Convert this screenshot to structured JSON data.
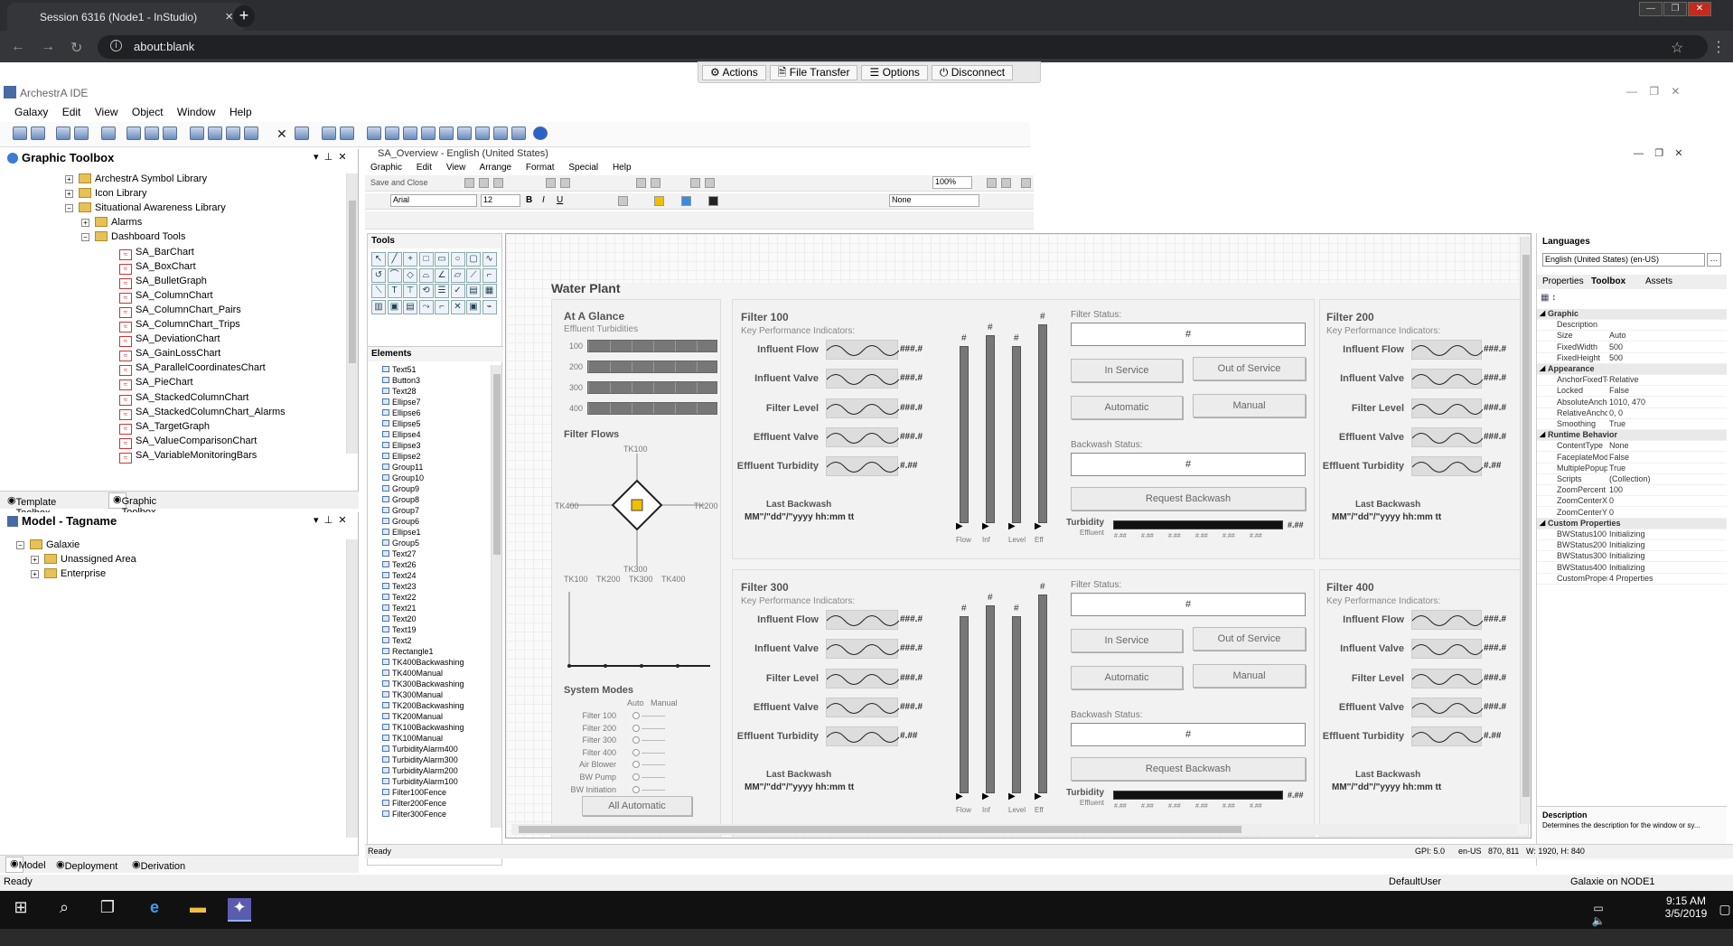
{
  "browser": {
    "tab_title": "Session 6316 (Node1 - InStudio)",
    "new_tab": "+",
    "close_tab": "×",
    "address": "about:blank",
    "minimize": "—",
    "restore": "❐",
    "close": "✕"
  },
  "session_bar": {
    "actions": "Actions",
    "file_transfer": "File Transfer",
    "options": "Options",
    "disconnect": "Disconnect"
  },
  "ide": {
    "title": "ArchestrA IDE",
    "menu": [
      "Galaxy",
      "Edit",
      "View",
      "Object",
      "Window",
      "Help"
    ]
  },
  "graphic_toolbox": {
    "title": "Graphic Toolbox",
    "tree": [
      {
        "label": "ArchestrA Symbol Library",
        "indent": 0,
        "kind": "folder",
        "expander": "+"
      },
      {
        "label": "Icon Library",
        "indent": 0,
        "kind": "folder",
        "expander": "+"
      },
      {
        "label": "Situational Awareness Library",
        "indent": 0,
        "kind": "folder",
        "expander": "−"
      },
      {
        "label": "Alarms",
        "indent": 1,
        "kind": "folder",
        "expander": "+"
      },
      {
        "label": "Dashboard Tools",
        "indent": 1,
        "kind": "folder",
        "expander": "−"
      },
      {
        "label": "SA_BarChart",
        "indent": 2,
        "kind": "graphic"
      },
      {
        "label": "SA_BoxChart",
        "indent": 2,
        "kind": "graphic"
      },
      {
        "label": "SA_BulletGraph",
        "indent": 2,
        "kind": "graphic"
      },
      {
        "label": "SA_ColumnChart",
        "indent": 2,
        "kind": "graphic"
      },
      {
        "label": "SA_ColumnChart_Pairs",
        "indent": 2,
        "kind": "graphic"
      },
      {
        "label": "SA_ColumnChart_Trips",
        "indent": 2,
        "kind": "graphic"
      },
      {
        "label": "SA_DeviationChart",
        "indent": 2,
        "kind": "graphic"
      },
      {
        "label": "SA_GainLossChart",
        "indent": 2,
        "kind": "graphic"
      },
      {
        "label": "SA_ParallelCoordinatesChart",
        "indent": 2,
        "kind": "graphic"
      },
      {
        "label": "SA_PieChart",
        "indent": 2,
        "kind": "graphic"
      },
      {
        "label": "SA_StackedColumnChart",
        "indent": 2,
        "kind": "graphic"
      },
      {
        "label": "SA_StackedColumnChart_Alarms",
        "indent": 2,
        "kind": "graphic"
      },
      {
        "label": "SA_TargetGraph",
        "indent": 2,
        "kind": "graphic"
      },
      {
        "label": "SA_ValueComparisonChart",
        "indent": 2,
        "kind": "graphic"
      },
      {
        "label": "SA_VariableMonitoringBars",
        "indent": 2,
        "kind": "graphic"
      }
    ],
    "tabs": [
      "Template Toolbox",
      "Graphic Toolbox"
    ]
  },
  "model_panel": {
    "title": "Model - Tagname",
    "tree": [
      {
        "label": "Galaxie",
        "indent": 0,
        "expander": "−"
      },
      {
        "label": "Unassigned Area",
        "indent": 1,
        "expander": "+"
      },
      {
        "label": "Enterprise",
        "indent": 1,
        "expander": "+"
      }
    ],
    "tabs": [
      "Model",
      "Deployment",
      "Derivation"
    ]
  },
  "editor": {
    "title": "SA_Overview - English (United States)",
    "menu": [
      "Graphic",
      "Edit",
      "View",
      "Arrange",
      "Format",
      "Special",
      "Help"
    ],
    "save_close": "Save and Close",
    "zoom": "100%",
    "font": "Arial",
    "font_size": "12",
    "style_none": "None",
    "tools_title": "Tools",
    "elements_title": "Elements",
    "elements": [
      "Text51",
      "Button3",
      "Text28",
      "Ellipse7",
      "Ellipse6",
      "Ellipse5",
      "Ellipse4",
      "Ellipse3",
      "Ellipse2",
      "Group11",
      "Group10",
      "Group9",
      "Group8",
      "Group7",
      "Group6",
      "Ellipse1",
      "Group5",
      "Text27",
      "Text26",
      "Text24",
      "Text23",
      "Text22",
      "Text21",
      "Text20",
      "Text19",
      "Text2",
      "Rectangle1",
      "TK400Backwashing",
      "TK400Manual",
      "TK300Backwashing",
      "TK300Manual",
      "TK200Backwashing",
      "TK200Manual",
      "TK100Backwashing",
      "TK100Manual",
      "TurbidityAlarm400",
      "TurbidityAlarm300",
      "TurbidityAlarm200",
      "TurbidityAlarm100",
      "Filter100Fence",
      "Filter200Fence",
      "Filter300Fence"
    ],
    "status": "Ready",
    "status_gpi": "GPI: 5.0",
    "status_lang": "en-US",
    "status_coord": "870, 811",
    "status_size": "W: 1920, H: 840"
  },
  "plant": {
    "title": "Water Plant",
    "glance": {
      "title": "At A Glance",
      "subtitle": "Effluent Turbidities",
      "rows": [
        "100",
        "200",
        "300",
        "400"
      ],
      "flows_title": "Filter Flows",
      "tk_top": "TK100",
      "tk_left": "TK400",
      "tk_right": "TK200",
      "tk_bottom": "TK300",
      "tk_axis": [
        "TK100",
        "TK200",
        "TK300",
        "TK400"
      ],
      "modes_title": "System Modes",
      "mode_cols": [
        "Auto",
        "Manual"
      ],
      "modes": [
        "Filter 100",
        "Filter 200",
        "Filter 300",
        "Filter 400",
        "Air Blower",
        "BW Pump",
        "BW Initiation"
      ],
      "all_auto": "All Automatic"
    },
    "kpi_label": "Key Performance Indicators:",
    "kpis": [
      "Influent Flow",
      "Influent Valve",
      "Filter Level",
      "Effluent Valve",
      "Effluent Turbidity"
    ],
    "kpi_value": "###.#",
    "kpi_value_turb": "#.##",
    "last_backwash": "Last Backwash",
    "backwash_fmt": "MM\"/\"dd\"/\"yyyy hh:mm tt",
    "bar_labels": [
      "Flow",
      "Inf",
      "Level",
      "Eff"
    ],
    "hash": "#",
    "filter_status": "Filter Status:",
    "in_service": "In Service",
    "out_service": "Out of Service",
    "automatic": "Automatic",
    "manual": "Manual",
    "backwash_status": "Backwash Status:",
    "request_backwash": "Request Backwash",
    "turbidity": "Turbidity",
    "effluent": "Effluent",
    "turb_value": "#.##",
    "turb_ticks": "#.##",
    "filters": [
      "Filter 100",
      "Filter 200",
      "Filter 300",
      "Filter 400"
    ]
  },
  "properties": {
    "languages_title": "Languages",
    "language": "English (United States) (en-US)",
    "tabs": [
      "Properties",
      "Toolbox",
      "Assets"
    ],
    "rows": [
      {
        "k": "Graphic",
        "v": "",
        "sec": true
      },
      {
        "k": "Description",
        "v": ""
      },
      {
        "k": "Size",
        "v": "Auto"
      },
      {
        "k": "FixedWidth",
        "v": "500"
      },
      {
        "k": "FixedHeight",
        "v": "500"
      },
      {
        "k": "Appearance",
        "v": "",
        "sec": true
      },
      {
        "k": "AnchorFixedTo",
        "v": "Relative"
      },
      {
        "k": "Locked",
        "v": "False"
      },
      {
        "k": "AbsoluteAnchor",
        "v": "1010, 470"
      },
      {
        "k": "RelativeAnchor",
        "v": "0, 0"
      },
      {
        "k": "Smoothing",
        "v": "True"
      },
      {
        "k": "Runtime Behavior",
        "v": "",
        "sec": true
      },
      {
        "k": "ContentType",
        "v": "None"
      },
      {
        "k": "FaceplateMod",
        "v": "False"
      },
      {
        "k": "MultiplePopup",
        "v": "True"
      },
      {
        "k": "Scripts",
        "v": "(Collection)"
      },
      {
        "k": "ZoomPercent",
        "v": "100"
      },
      {
        "k": "ZoomCenterX",
        "v": "0"
      },
      {
        "k": "ZoomCenterY",
        "v": "0"
      },
      {
        "k": "Custom Properties",
        "v": "",
        "sec": true
      },
      {
        "k": "BWStatus100",
        "v": "Initializing"
      },
      {
        "k": "BWStatus200",
        "v": "Initializing"
      },
      {
        "k": "BWStatus300",
        "v": "Initializing"
      },
      {
        "k": "BWStatus400",
        "v": "Initializing"
      },
      {
        "k": "CustomProperties",
        "v": "4 Properties"
      }
    ],
    "desc_title": "Description",
    "desc_text": "Determines the description for the window or sy..."
  },
  "ide_status": {
    "ready": "Ready",
    "user": "DefaultUser",
    "node": "Galaxie on NODE1"
  },
  "taskbar": {
    "time": "9:15 AM",
    "date": "3/5/2019"
  }
}
